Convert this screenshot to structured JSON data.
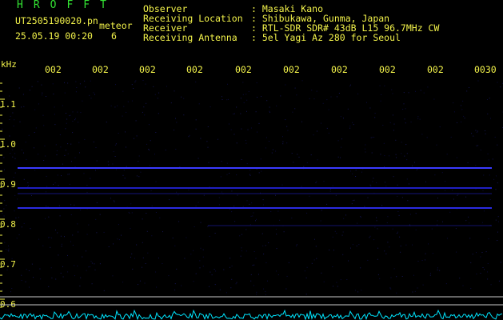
{
  "app": {
    "title": "HROFFT"
  },
  "file": {
    "name": "UT2505190020.pn",
    "type": "meteor",
    "datetime": "25.05.19 00:20",
    "count": "6"
  },
  "info": [
    {
      "label": "Observer",
      "value": ": Masaki Kano"
    },
    {
      "label": "Receiving Location",
      "value": ": Shibukawa, Gunma, Japan"
    },
    {
      "label": "Receiver",
      "value": ": RTL-SDR SDR# 43dB L15 96.7MHz CW"
    },
    {
      "label": "Receiving Antenna",
      "value": ": 5el Yagi Az 280 for Seoul"
    }
  ],
  "time_axis": {
    "ticks": [
      "002",
      "002",
      "002",
      "002",
      "002",
      "002",
      "002",
      "002",
      "002",
      "0030"
    ]
  },
  "freq_axis": {
    "unit": "kHz",
    "ticks": [
      "1.1",
      "1.0",
      "0.9",
      "0.8",
      "0.7",
      "0.6"
    ]
  },
  "colors": {
    "background": "#000000",
    "text": "#f2f24a",
    "title": "#33e333",
    "trace": "#3a3aff",
    "grid": "#c8c8c8",
    "noise": "#00ffff"
  }
}
